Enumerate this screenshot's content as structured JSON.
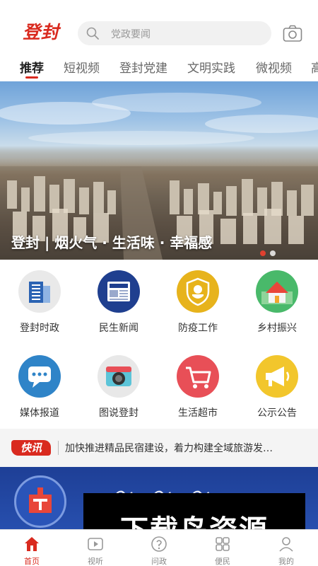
{
  "header": {
    "logo_text": "登封",
    "search_placeholder": "党政要闻"
  },
  "tabs": [
    {
      "label": "推荐",
      "active": true
    },
    {
      "label": "短视频"
    },
    {
      "label": "登封党建"
    },
    {
      "label": "文明实践"
    },
    {
      "label": "微视频"
    },
    {
      "label": "高"
    }
  ],
  "banner": {
    "caption": "登封 | 烟火气 · 生活味 · 幸福感",
    "slide_count": 2,
    "active_slide": 1
  },
  "grid": [
    {
      "label": "登封时政",
      "icon": "building-icon",
      "color": "#e9e9e9"
    },
    {
      "label": "民生新闻",
      "icon": "newspaper-icon",
      "color": "#1f3f8f"
    },
    {
      "label": "防疫工作",
      "icon": "shield-mask-icon",
      "color": "#e7b31c"
    },
    {
      "label": "乡村振兴",
      "icon": "house-icon",
      "color": "#49b96a"
    },
    {
      "label": "媒体报道",
      "icon": "chat-bubble-icon",
      "color": "#2f84c8"
    },
    {
      "label": "图说登封",
      "icon": "camera-icon",
      "color": "#e8e8e8"
    },
    {
      "label": "生活超市",
      "icon": "shopping-cart-icon",
      "color": "#e84f57"
    },
    {
      "label": "公示公告",
      "icon": "megaphone-icon",
      "color": "#f2c62c"
    }
  ],
  "ticker": {
    "badge": "快讯",
    "text": "加快推进精品民宿建设，着力构建全域旅游发…"
  },
  "watermark": "下载鸟资源",
  "bottom_nav": [
    {
      "label": "首页",
      "icon": "home-icon",
      "active": true
    },
    {
      "label": "视听",
      "icon": "play-icon"
    },
    {
      "label": "问政",
      "icon": "question-icon"
    },
    {
      "label": "便民",
      "icon": "service-icon"
    },
    {
      "label": "我的",
      "icon": "user-icon"
    }
  ],
  "colors": {
    "accent": "#d92a1f"
  }
}
